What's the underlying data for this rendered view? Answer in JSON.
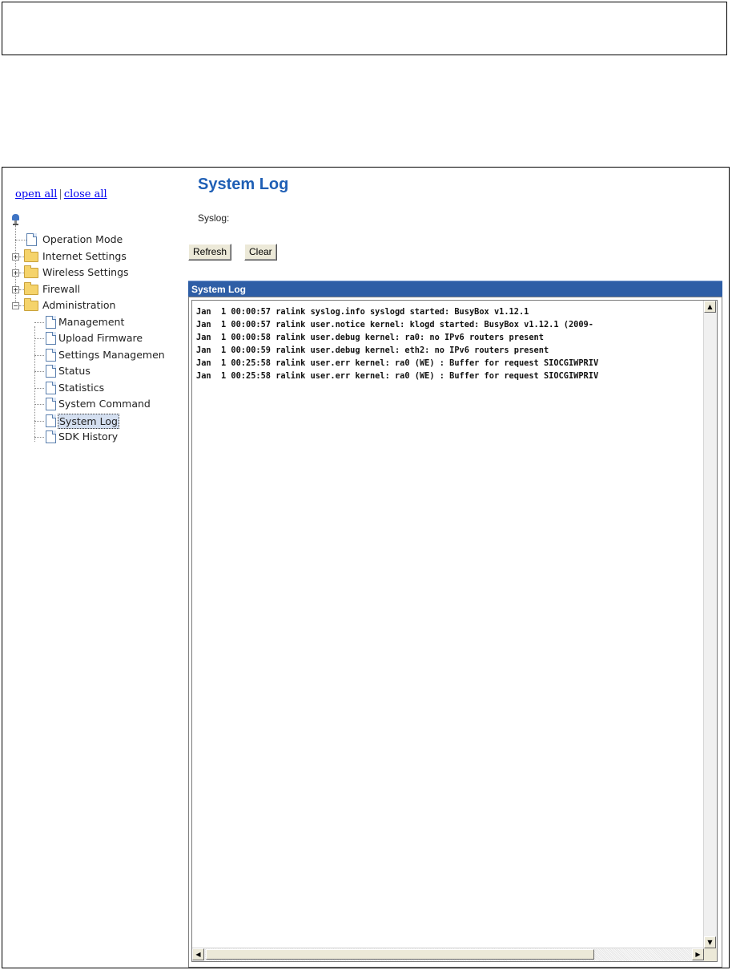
{
  "nav": {
    "open_all": "open all",
    "separator": "|",
    "close_all": "close all",
    "tree": [
      {
        "label": "Operation Mode",
        "type": "page",
        "level": 1
      },
      {
        "label": "Internet Settings",
        "type": "folder",
        "level": 1,
        "expanded": false
      },
      {
        "label": "Wireless Settings",
        "type": "folder",
        "level": 1,
        "expanded": false
      },
      {
        "label": "Firewall",
        "type": "folder",
        "level": 1,
        "expanded": false
      },
      {
        "label": "Administration",
        "type": "folder",
        "level": 1,
        "expanded": true
      },
      {
        "label": "Management",
        "type": "page",
        "level": 2
      },
      {
        "label": "Upload Firmware",
        "type": "page",
        "level": 2
      },
      {
        "label": "Settings Managemen",
        "type": "page",
        "level": 2
      },
      {
        "label": "Status",
        "type": "page",
        "level": 2
      },
      {
        "label": "Statistics",
        "type": "page",
        "level": 2
      },
      {
        "label": "System Command",
        "type": "page",
        "level": 2
      },
      {
        "label": "System Log",
        "type": "page",
        "level": 2,
        "selected": true
      },
      {
        "label": "SDK History",
        "type": "page",
        "level": 2
      }
    ]
  },
  "main": {
    "title": "System Log",
    "syslog_label": "Syslog:",
    "refresh_label": "Refresh",
    "clear_label": "Clear",
    "panel_title": "System Log",
    "log_lines": [
      "Jan  1 00:00:57 ralink syslog.info syslogd started: BusyBox v1.12.1",
      "Jan  1 00:00:57 ralink user.notice kernel: klogd started: BusyBox v1.12.1 (2009-",
      "Jan  1 00:00:58 ralink user.debug kernel: ra0: no IPv6 routers present",
      "Jan  1 00:00:59 ralink user.debug kernel: eth2: no IPv6 routers present",
      "Jan  1 00:25:58 ralink user.err kernel: ra0 (WE) : Buffer for request SIOCGIWPRIV",
      "Jan  1 00:25:58 ralink user.err kernel: ra0 (WE) : Buffer for request SIOCGIWPRIV"
    ]
  },
  "icons": {
    "root": "network-computer-icon",
    "folder": "folder-icon",
    "page": "page-icon",
    "expand": "plus-expander-icon",
    "collapse": "minus-expander-icon"
  },
  "colors": {
    "title": "#1f5fb5",
    "panel_header": "#2e5ea6",
    "link": "#0000ee"
  }
}
